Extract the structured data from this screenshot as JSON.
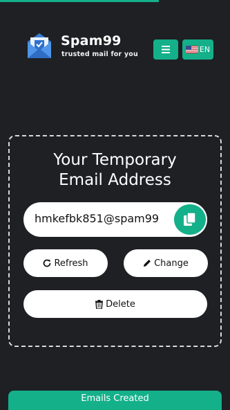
{
  "progress": 0.69,
  "colors": {
    "accent": "#14b08a",
    "background": "#1e2024",
    "button_bg": "#ffffff"
  },
  "header": {
    "brand_name": "Spam99",
    "tagline": "trusted mail for you",
    "menu_icon": "hamburger-icon",
    "language": {
      "flag_icon": "us-flag-icon",
      "code": "EN"
    }
  },
  "card": {
    "title": "Your Temporary\nEmail Address",
    "email": "hmkefbk851@spam99",
    "copy_icon": "copy-icon",
    "buttons": {
      "refresh": "Refresh",
      "change": "Change",
      "delete": "Delete"
    }
  },
  "stats": {
    "label": "Emails Created"
  }
}
